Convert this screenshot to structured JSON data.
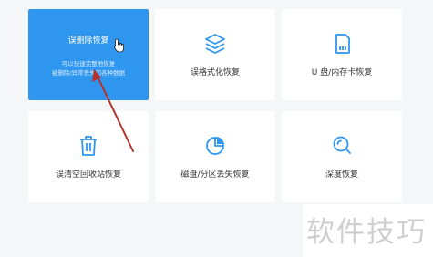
{
  "cards": [
    {
      "title": "误删除恢复",
      "desc_line1": "可以快速完整地恢复",
      "desc_line2": "被删除/异常丢失的各种数据",
      "icon": "hand-cursor-icon"
    },
    {
      "label": "误格式化恢复",
      "icon": "layers-icon"
    },
    {
      "label": "U 盘/内存卡恢复",
      "icon": "sd-card-icon"
    },
    {
      "label": "误清空回收站恢复",
      "icon": "trash-icon"
    },
    {
      "label": "磁盘/分区丢失恢复",
      "icon": "pie-chart-icon"
    },
    {
      "label": "深度恢复",
      "icon": "magnifier-icon"
    }
  ],
  "watermark": "软件技巧",
  "colors": {
    "accent": "#2f96ef",
    "icon": "#2f96ef",
    "annotation_arrow": "#b5322e",
    "background": "#f5f6f8"
  }
}
